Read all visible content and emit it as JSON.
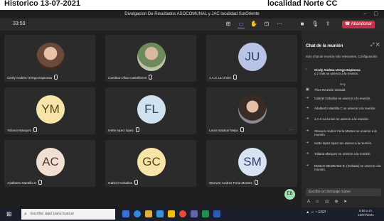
{
  "banner": {
    "left": "Historico 13-07-2021",
    "right": "localidad Norte CC"
  },
  "window": {
    "title": "Divulgacion De Resultados ASOCOMUNAL y JAC localidad SurOriente"
  },
  "toolbar": {
    "timer": "33:59",
    "leave_label": "Abandonar"
  },
  "participants": [
    {
      "name": "Cindy Andrea Urrego Espinosa",
      "initials": "",
      "avatar_color": ""
    },
    {
      "name": "Carolina Ulloa Castellanos",
      "initials": "",
      "avatar_color": ""
    },
    {
      "name": "J.A.C La Union",
      "initials": "JU",
      "avatar_color": "#b8c4e6"
    },
    {
      "name": "Yoliana Marquez",
      "initials": "YM",
      "avatar_color": "#f6e4a8"
    },
    {
      "name": "Ivette lopez lopez",
      "initials": "FL",
      "avatar_color": "#cfe2ee"
    },
    {
      "name": "Laura Salazar Mejia",
      "initials": "",
      "avatar_color": ""
    },
    {
      "name": "Adalberto Mantilla C",
      "initials": "AC",
      "avatar_color": "#f2dfd4"
    },
    {
      "name": "Gabriel Ceballos",
      "initials": "GC",
      "avatar_color": "#f6e4a8"
    },
    {
      "name": "Steeven Andres Feria Montes",
      "initials": "SM",
      "avatar_color": "#d9e2f3"
    }
  ],
  "self_view": {
    "initials": "EB"
  },
  "chat": {
    "title": "Chat de la reunión",
    "notice": "Solo chat de reunión sólo relevantes. Configuración",
    "pinned": {
      "name": "Cindy Andrea Urrego Espinosa",
      "text": "y 2 más se unieron a la reunión."
    },
    "today_label": "Hoy",
    "messages": [
      {
        "time": "7h44",
        "text": "Reunión iniciada"
      },
      {
        "time": "",
        "text": "Gabriel Ceballos se unieron a la reunión."
      },
      {
        "time": "",
        "text": "Adalberto Mantilla C se unieron a la reunión."
      },
      {
        "time": "",
        "text": "J.A.C La Union se unieron a la reunión."
      },
      {
        "time": "",
        "text": "Steeven Andres Feria Montes se unieron a la reunión."
      },
      {
        "time": "",
        "text": "Ivette lopez lopez se unieron a la reunión."
      },
      {
        "time": "",
        "text": "Yoliana Marquez se unieron a la reunión."
      },
      {
        "time": "",
        "text": "EMILIO MEDRANO B. (Invitado) se unieron a la reunión."
      }
    ],
    "input_placeholder": "Escribe un mensaje nuevo"
  },
  "taskbar": {
    "search_placeholder": "Escribe aquí para buscar",
    "clock_time": "9:58 a.m.",
    "clock_date": "13/07/2021"
  }
}
